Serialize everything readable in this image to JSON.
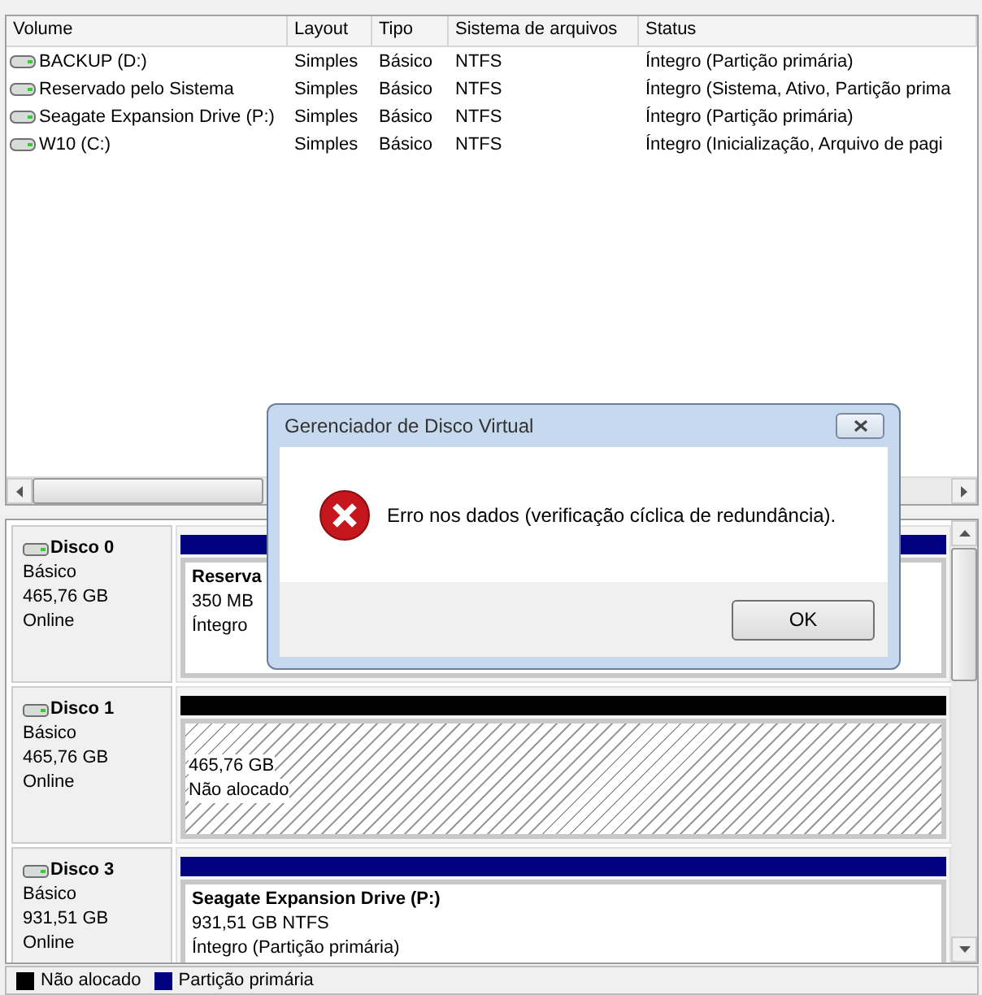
{
  "volume_table": {
    "columns": [
      "Volume",
      "Layout",
      "Tipo",
      "Sistema de arquivos",
      "Status"
    ],
    "rows": [
      [
        "BACKUP (D:)",
        "Simples",
        "Básico",
        "NTFS",
        "Íntegro (Partição primária)"
      ],
      [
        "Reservado pelo Sistema",
        "Simples",
        "Básico",
        "NTFS",
        "Íntegro (Sistema, Ativo, Partição prima"
      ],
      [
        "Seagate Expansion Drive (P:)",
        "Simples",
        "Básico",
        "NTFS",
        "Íntegro (Partição primária)"
      ],
      [
        "W10 (C:)",
        "Simples",
        "Básico",
        "NTFS",
        "Íntegro (Inicialização, Arquivo de pagi"
      ]
    ]
  },
  "disks": [
    {
      "name": "Disco 0",
      "type": "Básico",
      "size": "465,76 GB",
      "status": "Online",
      "partitions": [
        {
          "kind": "primary",
          "title": "Reserva",
          "lines": [
            "350 MB",
            "Íntegro"
          ]
        }
      ]
    },
    {
      "name": "Disco 1",
      "type": "Básico",
      "size": "465,76 GB",
      "status": "Online",
      "partitions": [
        {
          "kind": "unallocated",
          "lines": [
            "465,76 GB",
            "Não alocado"
          ]
        }
      ]
    },
    {
      "name": "Disco 3",
      "type": "Básico",
      "size": "931,51 GB",
      "status": "Online",
      "partitions": [
        {
          "kind": "primary",
          "title": "Seagate Expansion Drive  (P:)",
          "lines": [
            "931,51 GB NTFS",
            "Íntegro (Partição primária)"
          ]
        }
      ]
    }
  ],
  "legend": [
    {
      "label": "Não alocado",
      "color": "#000000"
    },
    {
      "label": "Partição primária",
      "color": "#000080"
    }
  ],
  "dialog": {
    "title": "Gerenciador de Disco Virtual",
    "message": "Erro nos dados (verificação cíclica de redundância).",
    "buttons": [
      "OK"
    ]
  }
}
